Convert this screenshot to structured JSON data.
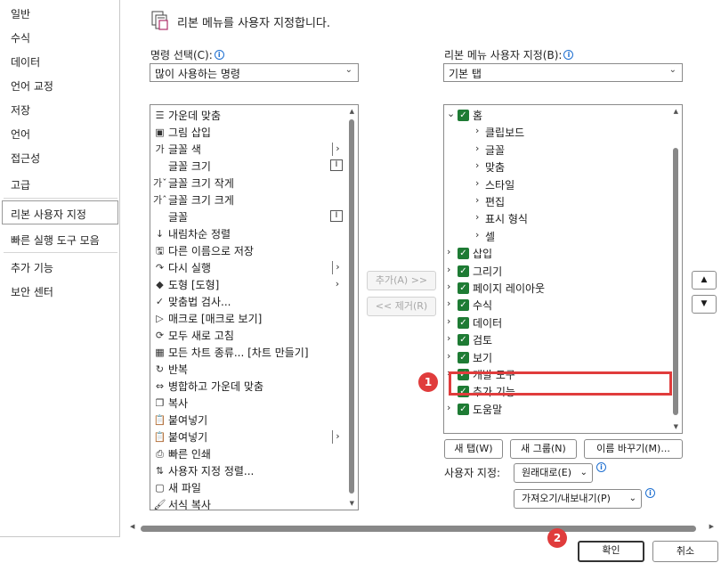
{
  "nav": {
    "items": [
      "일반",
      "수식",
      "데이터",
      "언어 교정",
      "저장",
      "언어",
      "접근성",
      "고급",
      "리본 사용자 지정",
      "빠른 실행 도구 모음",
      "추가 기능",
      "보안 센터"
    ],
    "selected": "리본 사용자 지정"
  },
  "header": {
    "title": "리본 메뉴를 사용자 지정합니다."
  },
  "left": {
    "label": "명령 선택(C):",
    "combo_value": "많이 사용하는 명령",
    "commands": [
      {
        "icon": "align-center-icon",
        "glyph": "☰",
        "label": "가운데 맞춤"
      },
      {
        "icon": "insert-picture-icon",
        "glyph": "▣",
        "label": "그림 삽입"
      },
      {
        "icon": "font-color-icon",
        "glyph": "가",
        "label": "글꼴 색",
        "extra": "submenu"
      },
      {
        "icon": "blank-icon",
        "glyph": "",
        "label": "글꼴 크기",
        "extra": "editbox"
      },
      {
        "icon": "decrease-font-icon",
        "glyph": "가ˇ",
        "label": "글꼴 크기 작게"
      },
      {
        "icon": "increase-font-icon",
        "glyph": "가ˆ",
        "label": "글꼴 크기 크게"
      },
      {
        "icon": "blank-icon",
        "glyph": "",
        "label": "글꼴",
        "extra": "editbox"
      },
      {
        "icon": "sort-descending-icon",
        "glyph": "↓",
        "label": "내림차순 정렬"
      },
      {
        "icon": "save-as-icon",
        "glyph": "🖫",
        "label": "다른 이름으로 저장"
      },
      {
        "icon": "redo-icon",
        "glyph": "↷",
        "label": "다시 실행",
        "extra": "submenu"
      },
      {
        "icon": "shapes-icon",
        "glyph": "◆",
        "label": "도형 [도형]",
        "extra": "arrow"
      },
      {
        "icon": "spell-check-icon",
        "glyph": "✓",
        "label": "맞춤법 검사..."
      },
      {
        "icon": "macro-icon",
        "glyph": "▷",
        "label": "매크로 [매크로 보기]"
      },
      {
        "icon": "refresh-all-icon",
        "glyph": "⟳",
        "label": "모두 새로 고침"
      },
      {
        "icon": "all-charts-icon",
        "glyph": "▦",
        "label": "모든 차트 종류... [차트 만들기]"
      },
      {
        "icon": "repeat-icon",
        "glyph": "↻",
        "label": "반복"
      },
      {
        "icon": "merge-center-icon",
        "glyph": "⇔",
        "label": "병합하고 가운데 맞춤"
      },
      {
        "icon": "copy-icon",
        "glyph": "❐",
        "label": "복사"
      },
      {
        "icon": "paste-icon",
        "glyph": "📋",
        "label": "붙여넣기"
      },
      {
        "icon": "paste-icon",
        "glyph": "📋",
        "label": "붙여넣기",
        "extra": "submenu"
      },
      {
        "icon": "quick-print-icon",
        "glyph": "⎙",
        "label": "빠른 인쇄"
      },
      {
        "icon": "custom-sort-icon",
        "glyph": "⇅",
        "label": "사용자 지정 정렬..."
      },
      {
        "icon": "new-file-icon",
        "glyph": "▢",
        "label": "새 파일"
      },
      {
        "icon": "format-painter-icon",
        "glyph": "🖌",
        "label": "서식 복사"
      }
    ]
  },
  "middle": {
    "add_label": "추가(A) >>",
    "remove_label": "<< 제거(R)"
  },
  "right": {
    "label": "리본 메뉴 사용자 지정(B):",
    "combo_value": "기본 탭",
    "tree": [
      {
        "level": 0,
        "expanded": true,
        "checked": true,
        "label": "홈"
      },
      {
        "level": 1,
        "label": "클립보드"
      },
      {
        "level": 1,
        "label": "글꼴"
      },
      {
        "level": 1,
        "label": "맞춤"
      },
      {
        "level": 1,
        "label": "스타일"
      },
      {
        "level": 1,
        "label": "편집"
      },
      {
        "level": 1,
        "label": "표시 형식"
      },
      {
        "level": 1,
        "label": "셀"
      },
      {
        "level": 0,
        "checked": true,
        "label": "삽입"
      },
      {
        "level": 0,
        "checked": true,
        "label": "그리기"
      },
      {
        "level": 0,
        "checked": true,
        "label": "페이지 레이아웃"
      },
      {
        "level": 0,
        "checked": true,
        "label": "수식"
      },
      {
        "level": 0,
        "checked": true,
        "label": "데이터"
      },
      {
        "level": 0,
        "checked": true,
        "label": "검토"
      },
      {
        "level": 0,
        "checked": true,
        "label": "보기"
      },
      {
        "level": 0,
        "checked": true,
        "label": "개발 도구",
        "focused": true
      },
      {
        "level": 0,
        "checked": true,
        "label": "추가 기능",
        "nochevron": true
      },
      {
        "level": 0,
        "checked": true,
        "label": "도움말"
      }
    ],
    "new_tab": "새 탭(W)",
    "new_group": "새 그룹(N)",
    "rename": "이름 바꾸기(M)...",
    "customize_label": "사용자 지정:",
    "reset_label": "원래대로(E)",
    "import_export_label": "가져오기/내보내기(P)"
  },
  "footer": {
    "ok": "확인",
    "cancel": "취소"
  },
  "badges": [
    "1",
    "2"
  ],
  "colors": {
    "check_green": "#1e7b34",
    "highlight_red": "#e03c3c",
    "info_blue": "#1e6fd0"
  }
}
